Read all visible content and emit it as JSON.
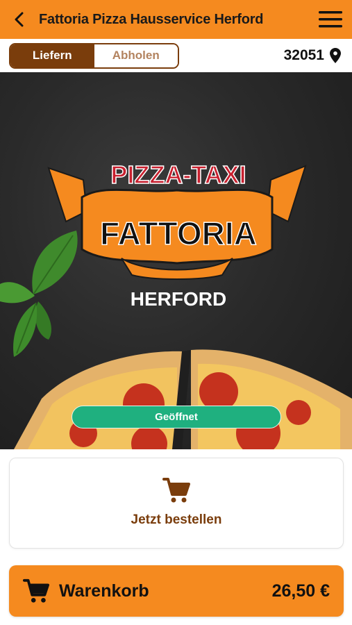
{
  "header": {
    "title": "Fattoria Pizza Hausservice Herford",
    "back_icon": "chevron-left-icon",
    "menu_icon": "hamburger-menu-icon"
  },
  "mode": {
    "options": [
      "Liefern",
      "Abholen"
    ],
    "selected": "Liefern"
  },
  "location": {
    "postal_code": "32051",
    "icon": "map-pin-icon"
  },
  "hero": {
    "logo_top": "PIZZA-TAXI",
    "logo_main": "FATTORIA",
    "logo_city": "HERFORD",
    "status": "Geöffnet"
  },
  "order": {
    "icon": "cart-icon",
    "label": "Jetzt bestellen"
  },
  "cart": {
    "icon": "cart-icon",
    "label": "Warenkorb",
    "total": "26,50 €"
  },
  "colors": {
    "brand_orange": "#f58a1f",
    "brand_brown": "#7a3d0c",
    "status_green": "#1fb07f"
  }
}
